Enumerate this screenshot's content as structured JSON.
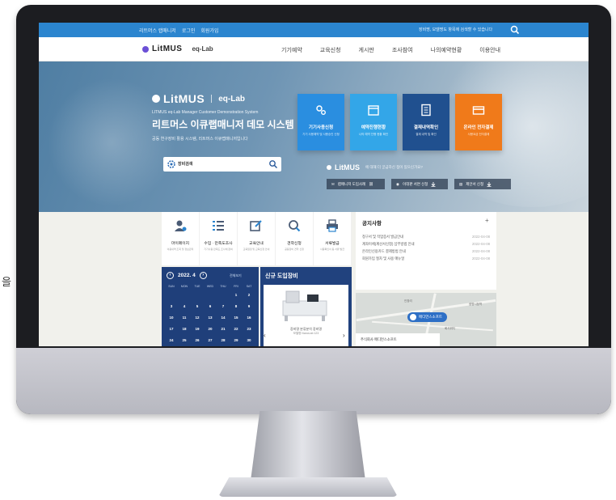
{
  "topbar": {
    "links": [
      "리트머스 랩매니저",
      "로그인",
      "회원가입"
    ],
    "notice": "장비명, 모델명도 항목에 검색할 수 있습니다"
  },
  "header": {
    "logo_word": "LitMUS",
    "logo_sub": "eq-Lab",
    "nav": [
      "기기예약",
      "교육신청",
      "게시판",
      "조사참여",
      "나의예약현황",
      "이용안내"
    ]
  },
  "hero": {
    "logo_word": "LitMUS",
    "logo_sub": "eq-Lab",
    "caption": "LITMUS eq-Lab Manager Customer Demonstration System",
    "title": "리트머스 이큐랩매니저 데모 시스템",
    "desc": "공동 연구장비 활용 시스템, 리트머스 이큐랩매니저입니다",
    "search_label": "장비검색"
  },
  "quick_cards": [
    {
      "title": "기기사용신청",
      "desc": "기기 사용예약 및 사용승인 신청",
      "color": "#2a8ee0"
    },
    {
      "title": "예약진행현황",
      "desc": "나의 예약 진행 현황 확인",
      "color": "#33a6e8"
    },
    {
      "title": "결재내역확인",
      "desc": "결제 내역 및 확인",
      "color": "#20508f"
    },
    {
      "title": "온라인 전자결제",
      "desc": "사용요금 전자결제",
      "color": "#f07a1a"
    }
  ],
  "faq": {
    "logo_word": "LitMUS",
    "question": "에 대해 더 궁금하신 점이 있으신가요?",
    "downloads": [
      "랩매니저 도입사례",
      "이데판 서면 신청",
      "제안서 신청"
    ]
  },
  "quick_menu": [
    {
      "title": "마이페이지",
      "desc": "이용내역 조회 및 정보관리"
    },
    {
      "title": "수입 · 만족도조사",
      "desc": "기기사용 만족도 조사에 참여"
    },
    {
      "title": "교육안내",
      "desc": "교육일정 및 교육신청 안내"
    },
    {
      "title": "견학신청",
      "desc": "공동장비 견학 신청"
    },
    {
      "title": "서류발급",
      "desc": "사용확인서 등 서류 발급"
    }
  ],
  "calendar": {
    "title": "2022. 4",
    "view_all": "전체보기",
    "dow": [
      "SUN",
      "MON",
      "TUE",
      "WED",
      "THU",
      "FRI",
      "SAT"
    ],
    "days": [
      "",
      "",
      "",
      "",
      "",
      "1",
      "2",
      "3",
      "4",
      "5",
      "6",
      "7",
      "8",
      "9",
      "10",
      "11",
      "12",
      "13",
      "14",
      "15",
      "16",
      "17",
      "18",
      "19",
      "20",
      "21",
      "22",
      "23",
      "24",
      "25",
      "26",
      "27",
      "28",
      "29",
      "30"
    ]
  },
  "equipment": {
    "title": "신규 도입장비",
    "caption": "장비명 분류분석 장비명",
    "sub": "모델명 NanoLab 123"
  },
  "notices": {
    "title": "공지사항",
    "items": [
      {
        "text": "청구서 및 작업증서 발급안내",
        "date": "2022-04-08"
      },
      {
        "text": "계좌이체(계산서신청) 납부방법 안내",
        "date": "2022-04-08"
      },
      {
        "text": "온라인신용카드 결제방법 안내",
        "date": "2022-04-08"
      },
      {
        "text": "회원가입 절차 및 사용 매뉴얼",
        "date": "2022-04-08"
      }
    ]
  },
  "map": {
    "pin": "메디언스소프트",
    "address": "주식회사 메디언스소프트",
    "labels": [
      "인창리",
      "광명시청역",
      "회사위치"
    ]
  },
  "stray_char": "을"
}
